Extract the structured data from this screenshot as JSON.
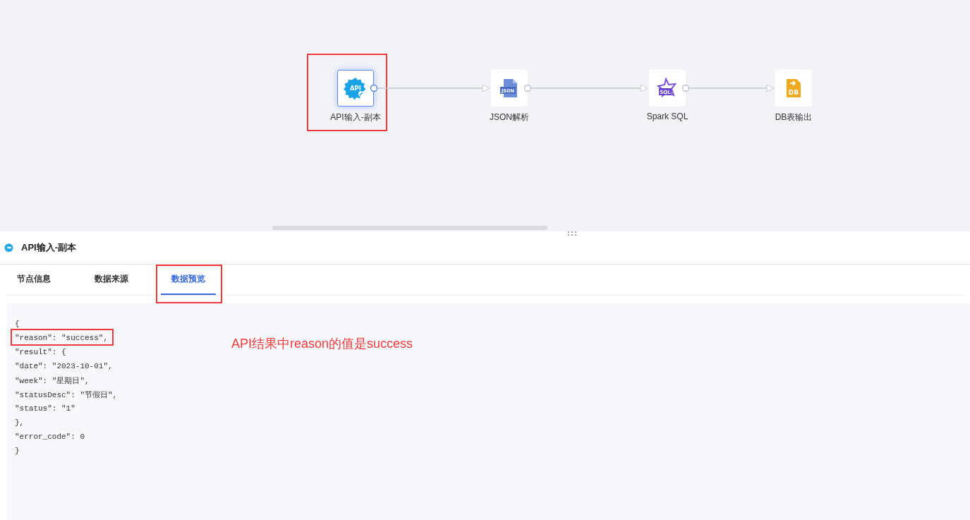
{
  "flow": {
    "nodes": [
      {
        "kind": "api",
        "icon_text": "API",
        "label": "API输入-副本",
        "selected": true,
        "highlighted": true
      },
      {
        "kind": "json",
        "icon_text": "JSON",
        "label": "JSON解析",
        "selected": false,
        "highlighted": false
      },
      {
        "kind": "sql",
        "icon_text": "SQL",
        "label": "Spark SQL",
        "selected": false,
        "highlighted": false
      },
      {
        "kind": "db",
        "icon_text": "DB",
        "label": "DB表输出",
        "selected": false,
        "highlighted": false
      }
    ]
  },
  "panel": {
    "title": "API输入-副本",
    "tabs": [
      {
        "label": "节点信息",
        "selected": false,
        "highlighted": false
      },
      {
        "label": "数据来源",
        "selected": false,
        "highlighted": false
      },
      {
        "label": "数据预览",
        "selected": true,
        "highlighted": true
      }
    ],
    "preview_lines": [
      {
        "text": "{",
        "highlighted": false
      },
      {
        "text": "\"reason\": \"success\",",
        "highlighted": true
      },
      {
        "text": "\"result\": {",
        "highlighted": false
      },
      {
        "text": "\"date\": \"2023-10-01\",",
        "highlighted": false
      },
      {
        "text": "\"week\": \"星期日\",",
        "highlighted": false
      },
      {
        "text": "\"statusDesc\": \"节假日\",",
        "highlighted": false
      },
      {
        "text": "\"status\": \"1\"",
        "highlighted": false
      },
      {
        "text": "},",
        "highlighted": false
      },
      {
        "text": "\"error_code\": 0",
        "highlighted": false
      },
      {
        "text": "}",
        "highlighted": false
      }
    ],
    "annotation": "API结果中reason的值是success"
  }
}
